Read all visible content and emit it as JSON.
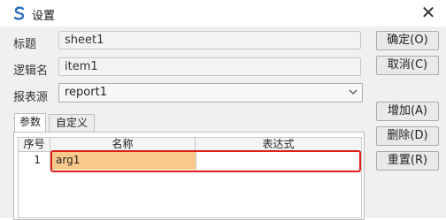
{
  "window": {
    "title": "设置",
    "close_glyph": "✕"
  },
  "form": {
    "title_label": "标题",
    "title_value": "sheet1",
    "logic_label": "逻辑名",
    "logic_value": "item1",
    "report_label": "报表源",
    "report_value": "report1"
  },
  "buttons": {
    "ok": "确定(O)",
    "cancel": "取消(C)",
    "add": "增加(A)",
    "delete": "删除(D)",
    "reset": "重置(R)"
  },
  "tabs": [
    {
      "label": "参数"
    },
    {
      "label": "自定义"
    }
  ],
  "grid": {
    "columns": [
      "序号",
      "名称",
      "表达式"
    ],
    "rows": [
      {
        "index": "1",
        "name": "arg1",
        "expr": ""
      }
    ]
  },
  "colors": {
    "selected_cell": "#f9c98c",
    "highlight_box": "#e0201a"
  },
  "icons": {
    "app": "app-logo-icon",
    "dropdown": "chevron-down-icon",
    "close": "close-icon"
  }
}
